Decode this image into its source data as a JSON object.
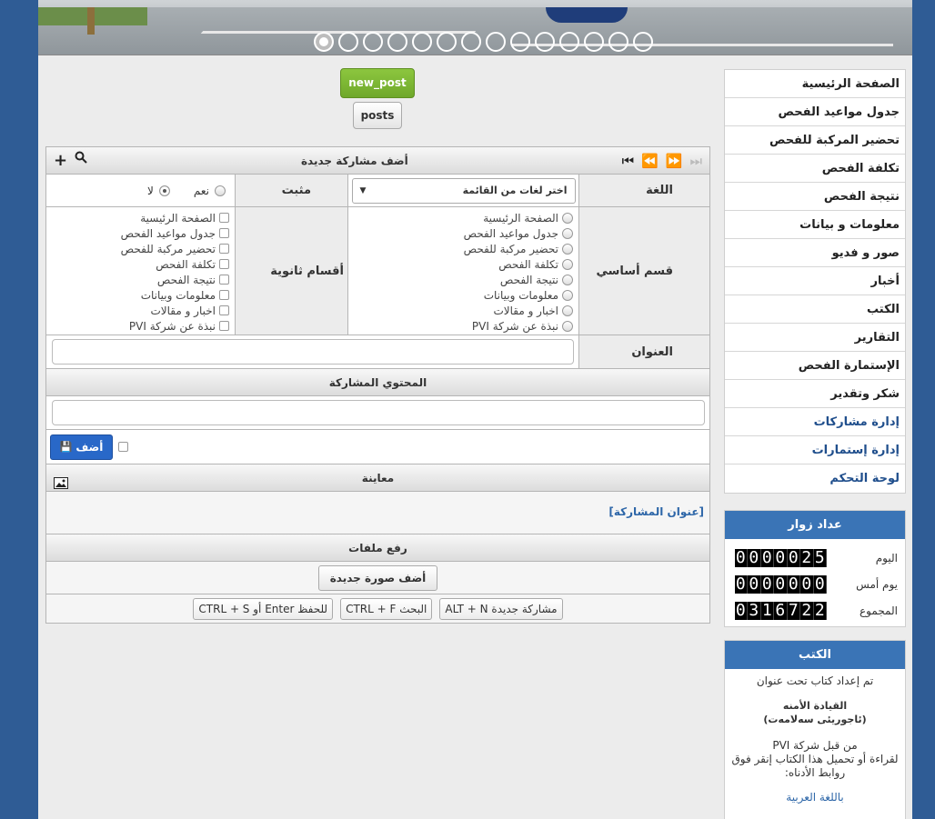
{
  "slider": {
    "dot_count": 14,
    "active_index": 0
  },
  "sidebar": {
    "items": [
      {
        "label": "الصفحة الرئيسية"
      },
      {
        "label": "جدول مواعيد الفحص"
      },
      {
        "label": "تحضير المركبة للفحص"
      },
      {
        "label": "تكلفة الفحص"
      },
      {
        "label": "نتيجة الفحص"
      },
      {
        "label": "معلومات و بيانات"
      },
      {
        "label": "صور و فديو"
      },
      {
        "label": "أخبار"
      },
      {
        "label": "الكتب"
      },
      {
        "label": "التقارير"
      },
      {
        "label": "الإستمارة الفحص"
      },
      {
        "label": "شكر وتقدير"
      },
      {
        "label": "إدارة مشاركات"
      },
      {
        "label": "إدارة إستمارات"
      },
      {
        "label": "لوحة التحكم"
      }
    ]
  },
  "counter": {
    "title": "عداد زوار",
    "rows": [
      {
        "label": "اليوم",
        "value": "0000025"
      },
      {
        "label": "يوم أمس",
        "value": "0000000"
      },
      {
        "label": "المجموع",
        "value": "0316722"
      }
    ]
  },
  "books": {
    "title": "الكتب",
    "intro": "تم إعداد كتاب تحت عنوان",
    "book_title_ar": "القيادة الأمنه",
    "book_title_ku": "(ئاجوريئى سەلامەت)",
    "by": "من قبل شركة PVI",
    "instructions": "لقراءة أو تحميل هذا الكتاب إنقر فوق روابط الأدناه:",
    "link": "باللغة العربية"
  },
  "toolbar": {
    "new_post": "new_post",
    "posts": "posts"
  },
  "form": {
    "header_title": "أضف مشاركة جديدة",
    "language_label": "اللغة",
    "language_select": "اختر لغات من القائمة",
    "pinned_label": "مثبت",
    "yes": "نعم",
    "no": "لا",
    "main_section_label": "قسم أساسي",
    "main_sections": [
      "الصفحة الرئيسية",
      "جدول مواعيد الفحص",
      "تحضير مركبة للفحص",
      "تكلفة الفحص",
      "نتيجة الفحص",
      "معلومات وبيانات",
      "اخبار و مقالات",
      "نبذة عن شركة PVI"
    ],
    "secondary_label": "أقسام ثانوية",
    "secondary_sections": [
      "الصفحة الرئيسية",
      "جدول مواعيد الفحص",
      "تحضير مركبة للفحص",
      "تكلفة الفحص",
      "نتيجة الفحص",
      "معلومات وبيانات",
      "اخبار و مقالات",
      "نبذة عن شركة PVI"
    ],
    "title_label": "العنوان",
    "content_header": "المحتوي المشاركة",
    "add_button": "أضف",
    "preview_header": "معاينة",
    "preview_title": "[عنوان المشاركة]",
    "upload_header": "رفع ملفات",
    "add_image_button": "أضف صورة جديدة",
    "shortcut_new": "ALT + N مشاركة جديدة",
    "shortcut_search": "CTRL + F البحث",
    "shortcut_save": "CTRL + S أو Enter للحفظ"
  }
}
